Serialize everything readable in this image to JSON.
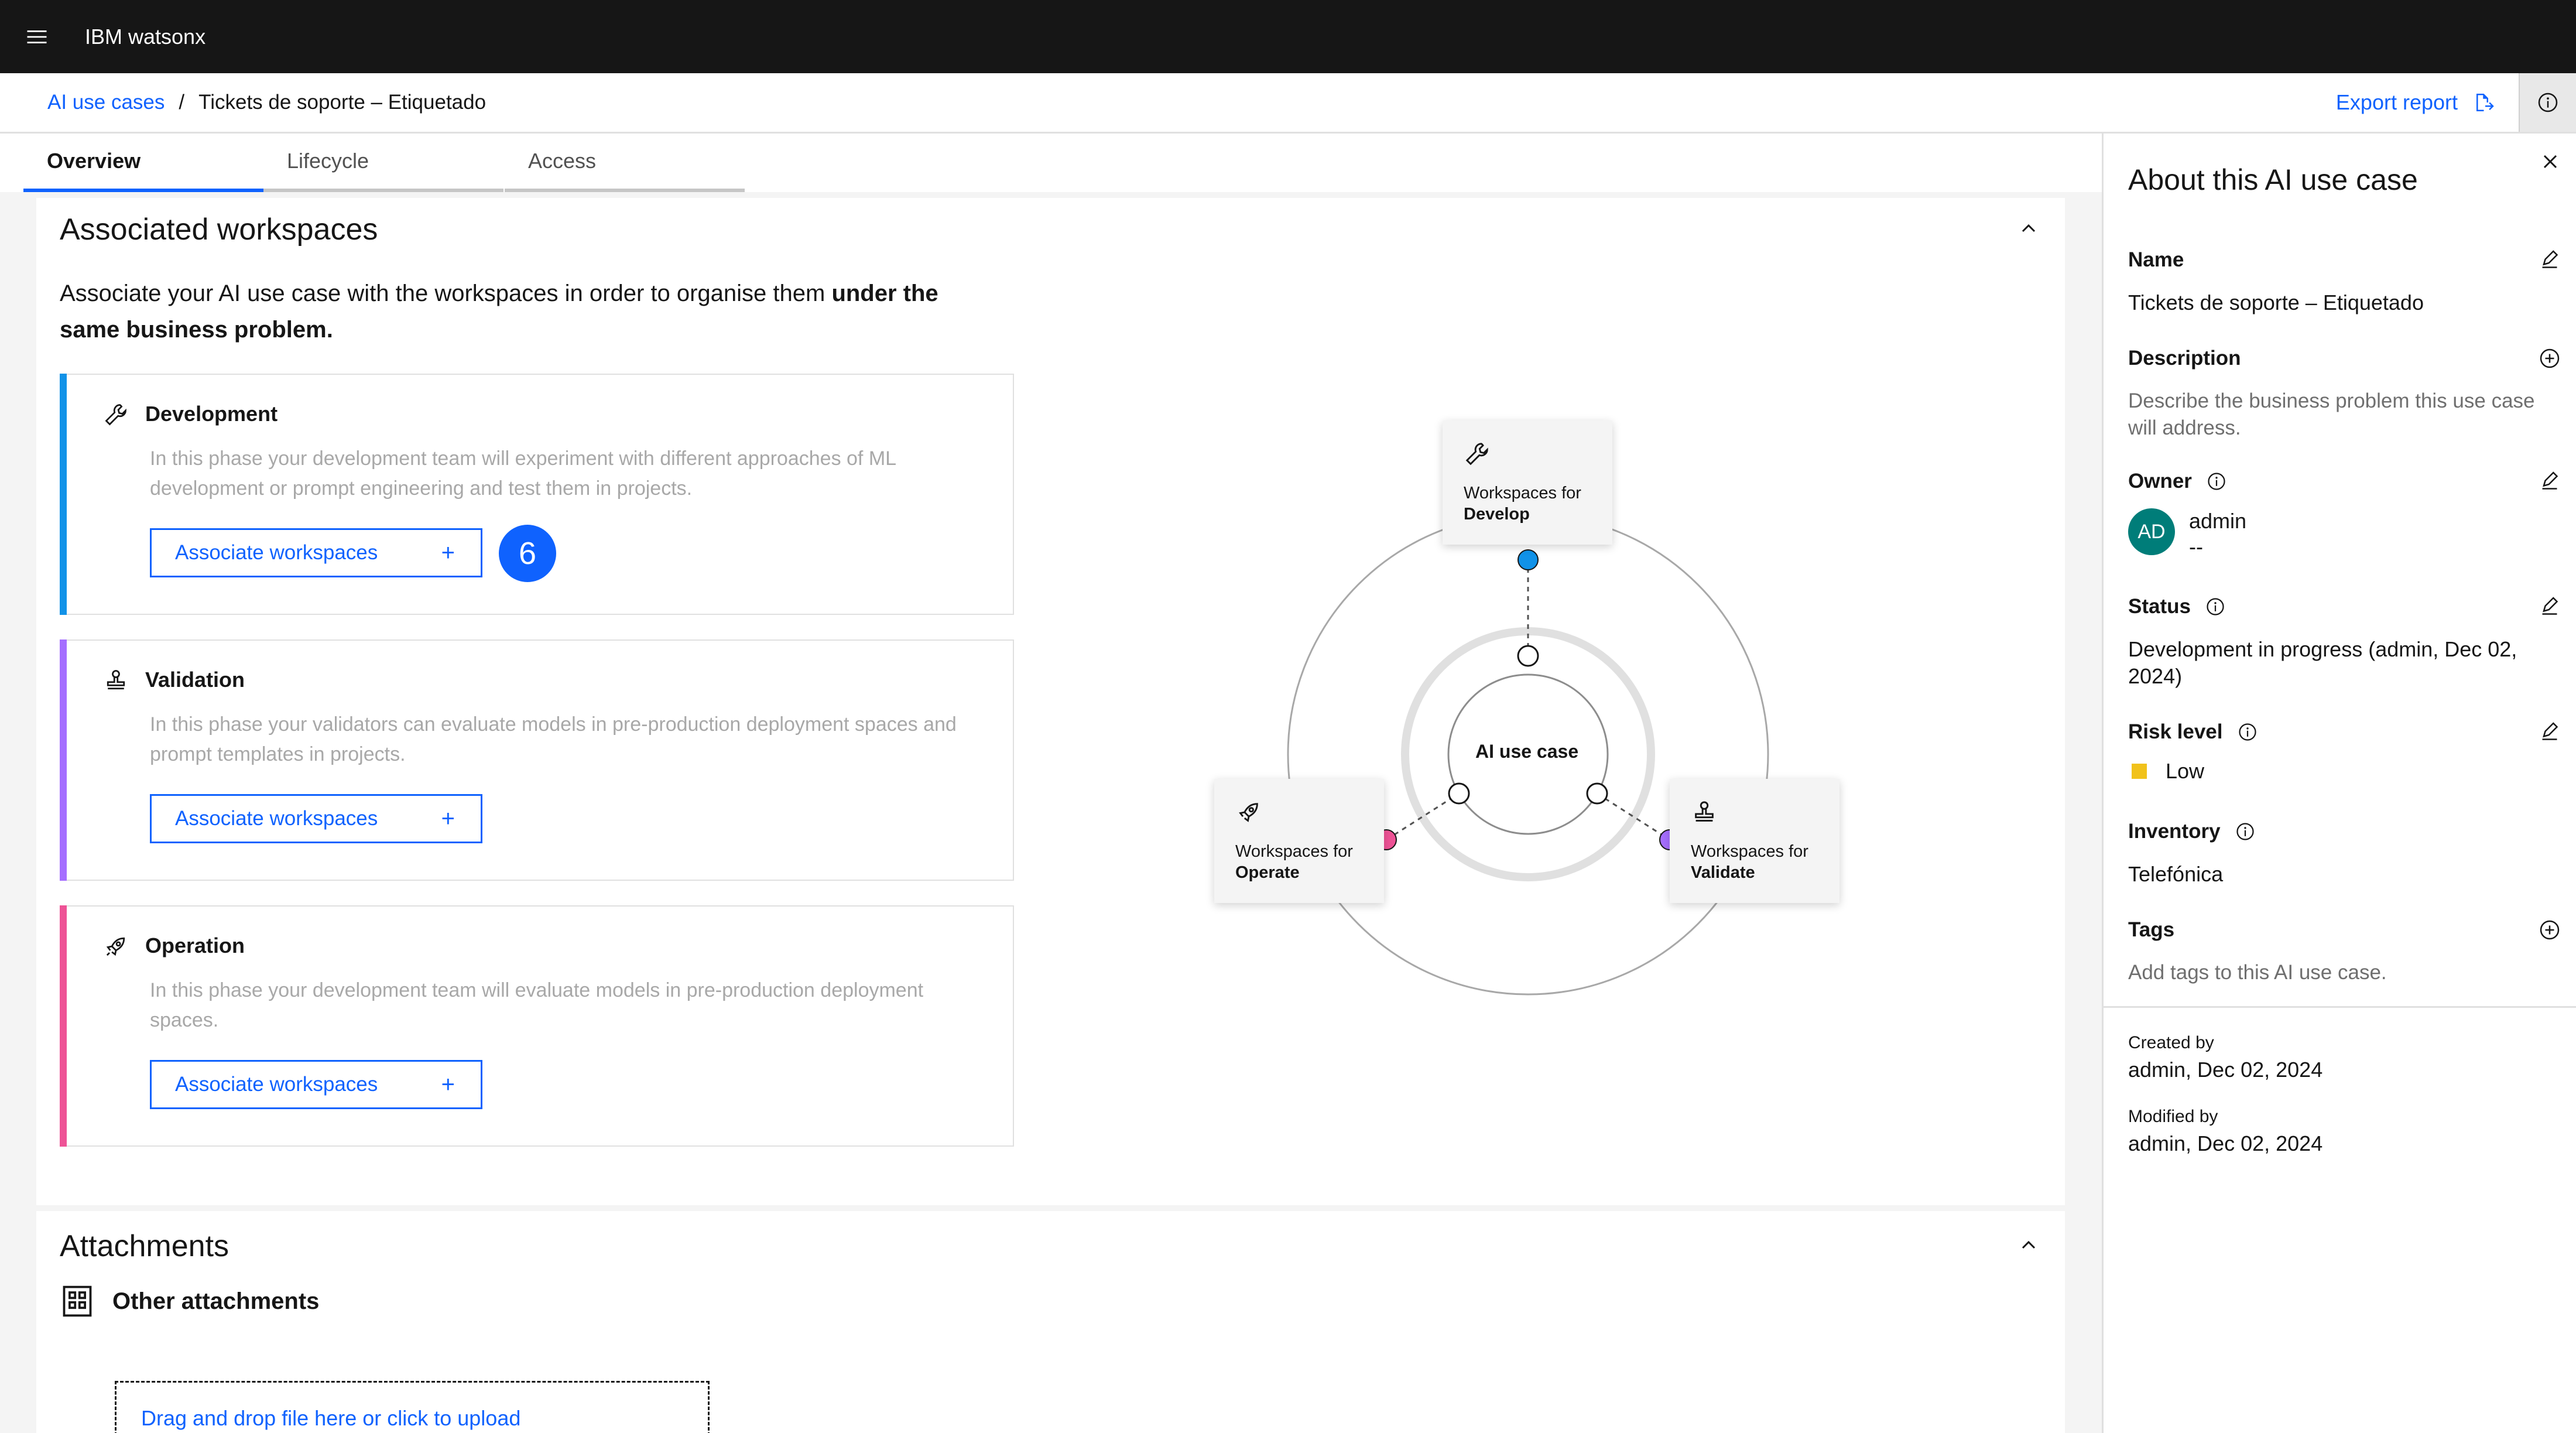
{
  "app": {
    "brand": "IBM watsonx"
  },
  "breadcrumb": {
    "parent": "AI use cases",
    "separator": "/",
    "current": "Tickets de soporte – Etiquetado"
  },
  "toolbar": {
    "export_label": "Export report"
  },
  "tabs": [
    {
      "label": "Overview",
      "active": true
    },
    {
      "label": "Lifecycle",
      "active": false
    },
    {
      "label": "Access",
      "active": false
    }
  ],
  "workspaces_section": {
    "title": "Associated workspaces",
    "intro_plain": "Associate your AI use case with the workspaces in order to organise them ",
    "intro_bold": "under the same business problem.",
    "phases": [
      {
        "title": "Development",
        "description": "In this phase your development team will experiment with different approaches of ML development or prompt engineering and test them in projects.",
        "button": "Associate workspaces",
        "color": "#1192e8",
        "icon": "wrench-icon"
      },
      {
        "title": "Validation",
        "description": "In this phase your validators can evaluate models in pre-production deployment spaces and prompt templates in projects.",
        "button": "Associate workspaces",
        "color": "#a56eff",
        "icon": "stamp-icon"
      },
      {
        "title": "Operation",
        "description": "In this phase your development team will evaluate models in pre-production deployment spaces.",
        "button": "Associate workspaces",
        "color": "#ee5396",
        "icon": "rocket-icon"
      }
    ],
    "step_badge": "6",
    "diagram": {
      "center": "AI use case",
      "develop": {
        "line1": "Workspaces for",
        "line2": "Develop"
      },
      "operate": {
        "line1": "Workspaces for",
        "line2": "Operate"
      },
      "validate": {
        "line1": "Workspaces for",
        "line2": "Validate"
      }
    }
  },
  "attachments_section": {
    "title": "Attachments",
    "subtitle": "Other attachments",
    "dropzone": "Drag and drop file here or click to upload"
  },
  "panel": {
    "title": "About this AI use case",
    "name_label": "Name",
    "name_value": "Tickets de soporte – Etiquetado",
    "description_label": "Description",
    "description_placeholder": "Describe the business problem this use case will address.",
    "owner_label": "Owner",
    "owner_initials": "AD",
    "owner_name": "admin",
    "owner_sub": "--",
    "status_label": "Status",
    "status_value": "Development in progress (admin, Dec 02, 2024)",
    "risk_label": "Risk level",
    "risk_value": "Low",
    "risk_color": "#f1c21b",
    "inventory_label": "Inventory",
    "inventory_value": "Telefónica",
    "tags_label": "Tags",
    "tags_placeholder": "Add tags to this AI use case.",
    "created_label": "Created by",
    "created_value": "admin, Dec 02, 2024",
    "modified_label": "Modified by",
    "modified_value": "admin, Dec 02, 2024"
  },
  "colors": {
    "accent": "#0f62fe",
    "header_bg": "#161616",
    "develop": "#1192e8",
    "validate": "#a56eff",
    "operate": "#ee5396"
  }
}
